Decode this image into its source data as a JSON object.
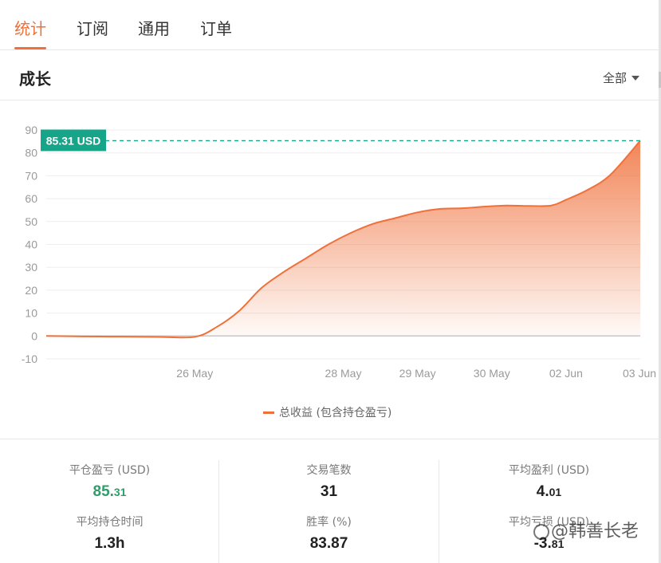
{
  "tabs": [
    {
      "label": "统计",
      "active": true
    },
    {
      "label": "订阅",
      "active": false
    },
    {
      "label": "通用",
      "active": false
    },
    {
      "label": "订单",
      "active": false
    }
  ],
  "section": {
    "title": "成长",
    "filter_label": "全部"
  },
  "colors": {
    "accent": "#f0703a",
    "badge": "#17a589",
    "positive": "#2e9e6a"
  },
  "chart_data": {
    "type": "area",
    "title": "",
    "xlabel": "",
    "ylabel": "",
    "ylim": [
      -10,
      90
    ],
    "yticks": [
      90,
      80,
      70,
      60,
      50,
      40,
      30,
      20,
      10,
      0,
      -10
    ],
    "xticks": [
      "26 May",
      "28 May",
      "29 May",
      "30 May",
      "02 Jun",
      "03 Jun"
    ],
    "grid": true,
    "legend_position": "bottom",
    "current_label": "85.31 USD",
    "current_value": 85.31,
    "series": [
      {
        "name": "总收益 (包含持仓盈亏)",
        "x": [
          -2,
          -1.5,
          -1,
          -0.5,
          0,
          0.3,
          0.6,
          0.9,
          1.2,
          1.5,
          1.8,
          2.1,
          2.4,
          2.7,
          3,
          3.3,
          3.6,
          3.9,
          4.2,
          4.5,
          4.8,
          5,
          5.3,
          5.6,
          6
        ],
        "values": [
          0,
          -0.2,
          -0.3,
          -0.4,
          -0.4,
          4,
          11,
          21,
          28,
          34,
          40,
          45,
          49,
          51.5,
          54,
          55.5,
          55.8,
          56.5,
          57,
          56.8,
          57,
          59.5,
          64,
          70.5,
          85.31
        ]
      }
    ]
  },
  "stats": [
    {
      "label": "平仓盈亏 (USD)",
      "value_main": "85.",
      "value_small": "31",
      "color": "green"
    },
    {
      "label": "交易笔数",
      "value_main": "31",
      "value_small": ""
    },
    {
      "label": "平均盈利 (USD)",
      "value_main": "4.",
      "value_small": "01"
    },
    {
      "label": "平均持仓时间",
      "value_main": "1.3h",
      "value_small": ""
    },
    {
      "label": "胜率 (%)",
      "value_main": "83.87",
      "value_small": ""
    },
    {
      "label": "平均亏损 (USD)",
      "value_main": "-3.",
      "value_small": "81"
    }
  ],
  "watermark": {
    "text": "@韩善长老"
  }
}
